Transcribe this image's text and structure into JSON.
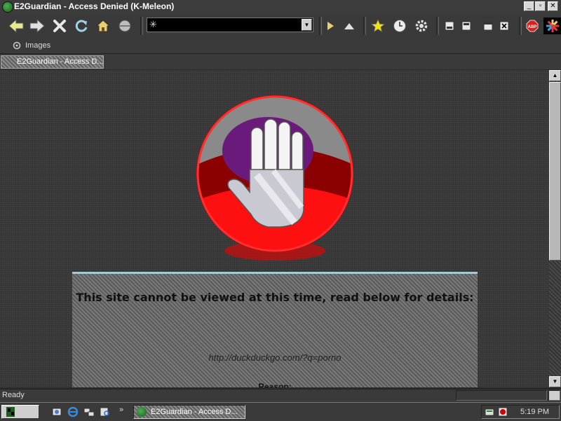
{
  "window": {
    "title": "E2Guardian - Access Denied (K-Meleon)"
  },
  "toolbar": {
    "url_value": "",
    "icons": [
      "back-icon",
      "forward-icon",
      "stop-icon",
      "reload-icon",
      "home-icon",
      "search-icon",
      "go-icon",
      "up-icon",
      "bookmarks-icon",
      "history-icon",
      "settings-icon",
      "minimize-doc-icon",
      "restore-doc-icon",
      "new-window-icon",
      "close-doc-icon",
      "adblock-icon",
      "throbber-icon"
    ]
  },
  "bookmarks_bar": {
    "items": [
      {
        "label": "Images"
      }
    ]
  },
  "tabs": [
    {
      "label": "E2Guardian - Access D..."
    }
  ],
  "page": {
    "heading": "This site cannot be viewed at this time, read below for details:",
    "blocked_url": "http://duckduckgo.com/?q=porno",
    "reason_label": "Reason:"
  },
  "status_bar": {
    "text": "Ready"
  },
  "taskbar": {
    "task_label": "E2Guardian - Access D...",
    "clock": "5:19 PM",
    "overflow": "»"
  },
  "colors": {
    "sign_red": "#ff0000",
    "sign_dark_red": "#8b0000",
    "panel_border": "#a9c8d6"
  }
}
